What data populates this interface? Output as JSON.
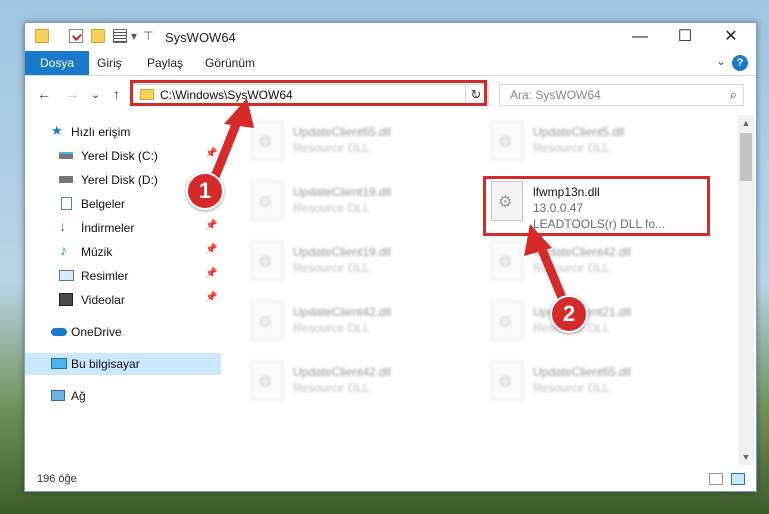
{
  "window": {
    "title": "SysWOW64",
    "minimize": "—",
    "maximize": "☐",
    "close": "✕"
  },
  "ribbon": {
    "tabs": [
      "Dosya",
      "Giriş",
      "Paylaş",
      "Görünüm"
    ],
    "chevron": "⌄",
    "help": "?"
  },
  "nav": {
    "back": "←",
    "forward": "→",
    "recent": "⌄",
    "up": "↑",
    "address": "C:\\Windows\\SysWOW64",
    "address_dropdown": "⌄",
    "refresh": "↻",
    "search_placeholder": "Ara: SysWOW64",
    "search_icon": "⌕"
  },
  "sidebar": {
    "items": [
      {
        "label": "Hızlı erişim",
        "icon": "star-icon"
      },
      {
        "label": "Yerel Disk (C:)",
        "icon": "drive-icon",
        "pinned": true
      },
      {
        "label": "Yerel Disk (D:)",
        "icon": "drive-icon",
        "pinned": true
      },
      {
        "label": "Belgeler",
        "icon": "documents-icon",
        "pinned": true
      },
      {
        "label": "İndirmeler",
        "icon": "downloads-icon",
        "pinned": true
      },
      {
        "label": "Müzik",
        "icon": "music-icon",
        "pinned": true
      },
      {
        "label": "Resimler",
        "icon": "pictures-icon",
        "pinned": true
      },
      {
        "label": "Videolar",
        "icon": "videos-icon",
        "pinned": true
      },
      {
        "label": "OneDrive",
        "icon": "cloud-icon"
      },
      {
        "label": "Bu bilgisayar",
        "icon": "computer-icon",
        "selected": true
      },
      {
        "label": "Ağ",
        "icon": "network-icon"
      }
    ],
    "pin_glyph": "📌"
  },
  "files": [
    {
      "name": "UpdateClient65.dll",
      "sub": "Resource DLL"
    },
    {
      "name": "UpdateClient5.dll",
      "sub": "Resource DLL"
    },
    {
      "name": "UpdateClient19.dll",
      "sub": "Resource DLL"
    },
    {
      "name": "lfwmp13n.dll",
      "sub": "13.0.0.47",
      "sub2": "LEADTOOLS(r) DLL fo...",
      "highlighted": true
    },
    {
      "name": "UpdateClient19.dll",
      "sub": "Resource DLL"
    },
    {
      "name": "UpdateClient42.dll",
      "sub": "Resource DLL"
    },
    {
      "name": "UpdateClient42.dll",
      "sub": "Resource DLL"
    },
    {
      "name": "UpdateClient21.dll",
      "sub": "Resource DLL"
    },
    {
      "name": "UpdateClient42.dll",
      "sub": "Resource DLL"
    },
    {
      "name": "UpdateClient65.dll",
      "sub": "Resource DLL"
    }
  ],
  "status": {
    "count": "196 öğe"
  },
  "annotations": {
    "badge1": "1",
    "badge2": "2",
    "color": "#d62a2a"
  },
  "colors": {
    "accent": "#1979ca",
    "selected": "#cce8ff",
    "folder": "#f6cf5c"
  }
}
